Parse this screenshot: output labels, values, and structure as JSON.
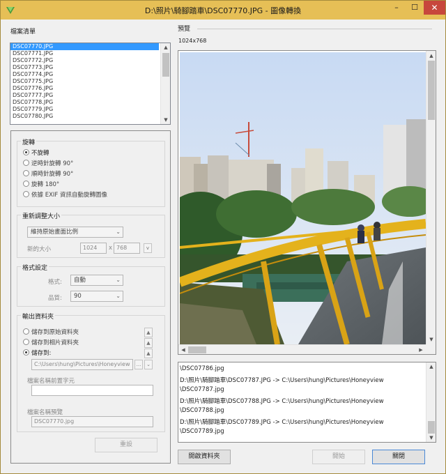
{
  "window": {
    "title": "D:\\照片\\騎腳踏車\\DSC07770.JPG - 圖像轉換",
    "minimize": "–",
    "maximize": "☐",
    "close": "✕"
  },
  "file_list": {
    "heading": "檔案清單",
    "items": [
      "DSC07770.JPG",
      "DSC07771.JPG",
      "DSC07772.JPG",
      "DSC07773.JPG",
      "DSC07774.JPG",
      "DSC07775.JPG",
      "DSC07776.JPG",
      "DSC07777.JPG",
      "DSC07778.JPG",
      "DSC07779.JPG",
      "DSC07780.JPG"
    ],
    "selected_index": 0
  },
  "rotation": {
    "label": "旋轉",
    "options": [
      "不旋轉",
      "逆時針旋轉 90°",
      "順時針旋轉 90°",
      "旋轉 180°",
      "依據 EXIF 資訊自動旋轉圖像"
    ],
    "selected_index": 0
  },
  "resize": {
    "label": "重新調整大小",
    "mode": "維持原始畫面比例",
    "new_size_label": "新的大小",
    "width": "1024",
    "times": "x",
    "height": "768",
    "dropdown_glyph": "v"
  },
  "format": {
    "label": "格式設定",
    "format_label": "格式:",
    "format_value": "自動",
    "quality_label": "品質:",
    "quality_value": "90"
  },
  "output": {
    "label": "輸出資料夾",
    "options": [
      "儲存到原始資料夾",
      "儲存到相片資料夾",
      "儲存到:"
    ],
    "selected_index": 2,
    "path": "C:\\Users\\hung\\Pictures\\Honeyview",
    "browse": "...",
    "prefix_label": "檔案名稱前置字元",
    "prefix_value": "",
    "preview_label": "檔案名稱預覽",
    "preview_value": "DSC07770.jpg"
  },
  "buttons": {
    "reset": "重設",
    "open_folder": "開啟資料夾",
    "start": "開始",
    "close": "關閉"
  },
  "preview": {
    "heading": "預覽",
    "dimensions": "1024x768"
  },
  "log": [
    "\\DSC07786.jpg",
    "D:\\照片\\騎腳踏車\\DSC07787.JPG -> C:\\Users\\hung\\Pictures\\Honeyview",
    "\\DSC07787.jpg",
    "D:\\照片\\騎腳踏車\\DSC07788.JPG -> C:\\Users\\hung\\Pictures\\Honeyview",
    "\\DSC07788.jpg",
    "D:\\照片\\騎腳踏車\\DSC07789.JPG -> C:\\Users\\hung\\Pictures\\Honeyview",
    "\\DSC07789.jpg"
  ],
  "colors": {
    "titlebar": "#e6bf56",
    "selection": "#3399ff",
    "close_button": "#c7473c"
  }
}
